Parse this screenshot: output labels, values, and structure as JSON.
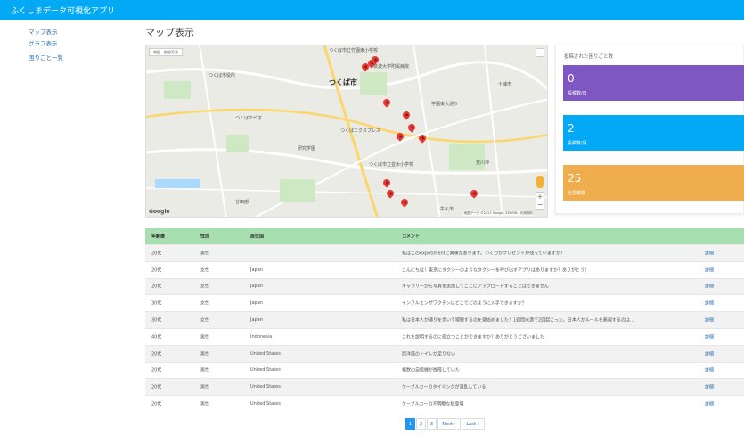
{
  "app": {
    "title": "ふくしまデータ可視化アプリ"
  },
  "sidebar": {
    "items": [
      {
        "label": "マップ表示"
      },
      {
        "label": "グラフ表示"
      },
      {
        "label": "困りごと一覧"
      }
    ]
  },
  "page": {
    "title": "マップ表示"
  },
  "map": {
    "city_label": "つくば市",
    "place_labels": [
      "つくば市立竹園東小学校",
      "筑波大学附属病院",
      "つくば市役所",
      "つくばエクスプレス",
      "研究学園",
      "つくば市立並木小学校",
      "谷田部",
      "土浦市",
      "牛久市",
      "荒川沖",
      "学園東大通り",
      "つくばカピオ"
    ],
    "map_type_label": "地図　航空写真",
    "logo": "Google",
    "attribution": "地図データ ©2017 Google, ZENRIN　利用規約",
    "zoom_in": "+",
    "zoom_out": "−"
  },
  "stats": {
    "title": "投稿された困りごと数",
    "cards": [
      {
        "value": "0",
        "label": "投稿数/日",
        "color": "#7e57c2"
      },
      {
        "value": "2",
        "label": "投稿数/月",
        "color": "#03a9f4"
      },
      {
        "value": "25",
        "label": "全投稿数",
        "color": "#f0ad4e"
      }
    ]
  },
  "table": {
    "headers": {
      "age": "年齢層",
      "sex": "性別",
      "residence": "居住国",
      "comment": "コメント"
    },
    "detail_label": "詳細",
    "rows": [
      {
        "age": "20代",
        "sex": "男性",
        "residence": "",
        "comment": "私はこのexpetimentに興味があります。いくつかプレゼントが残っていますか？"
      },
      {
        "age": "20代",
        "sex": "女性",
        "residence": "Japan",
        "comment": "こんにちは！東京にタクシーのようなタクシーを呼び出すアプリはありますか？ありがとう！"
      },
      {
        "age": "20代",
        "sex": "女性",
        "residence": "Japan",
        "comment": "ギャラリーから写真を追加してここにアップロードすることはできません"
      },
      {
        "age": "30代",
        "sex": "女性",
        "residence": "Japan",
        "comment": "インフルエンザワクチンはどこでどのように入手できますか？"
      },
      {
        "age": "30代",
        "sex": "女性",
        "residence": "Japan",
        "comment": "私は日本人が通りを歩いて喫煙するのを見始めました！1週間未満で2回起こった。日本人がルールを無視するのは..."
      },
      {
        "age": "40代",
        "sex": "男性",
        "residence": "Indonesia",
        "comment": "これを説明するのに役立つことができますか？ありがとうございました"
      },
      {
        "age": "20代",
        "sex": "男性",
        "residence": "United States",
        "comment": "西洋風のトイレが足りない"
      },
      {
        "age": "20代",
        "sex": "男性",
        "residence": "United States",
        "comment": "複数の自販機が故障していた"
      },
      {
        "age": "20代",
        "sex": "男性",
        "residence": "United States",
        "comment": "ケーブルカーのタイミングが混乱している"
      },
      {
        "age": "20代",
        "sex": "男性",
        "residence": "United States",
        "comment": "ケーブルカーの不明瞭な駐車場"
      }
    ]
  },
  "pagination": {
    "pages": [
      "1",
      "2",
      "3"
    ],
    "next": "Next ›",
    "last": "Last »"
  }
}
